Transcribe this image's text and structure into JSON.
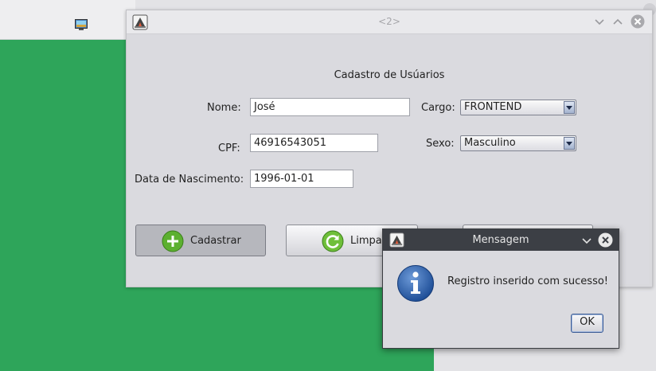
{
  "main_window": {
    "title": "<2>",
    "form_title": "Cadastro de Usúarios",
    "fields": {
      "nome": {
        "label": "Nome:",
        "value": "José"
      },
      "cpf": {
        "label": "CPF:",
        "value": "46916543051"
      },
      "nascimento": {
        "label": "Data de Nascimento:",
        "value": "1996-01-01"
      },
      "cargo": {
        "label": "Cargo:",
        "selected": "FRONTEND"
      },
      "sexo": {
        "label": "Sexo:",
        "selected": "Masculino"
      }
    },
    "buttons": {
      "cadastrar": "Cadastrar",
      "limpar": "Limpar"
    }
  },
  "dialog": {
    "title": "Mensagem",
    "message": "Registro inserido com sucesso!",
    "ok_label": "OK"
  },
  "colors": {
    "desktop_green": "#2ea55a",
    "dialog_titlebar": "#3c3f45",
    "info_blue": "#2c5fa8",
    "add_icon_green": "#5cb030"
  },
  "icons": [
    "java-app-icon",
    "minimize-icon",
    "maximize-icon",
    "close-icon",
    "add-icon",
    "refresh-icon",
    "info-icon",
    "dropdown-arrow-icon"
  ]
}
